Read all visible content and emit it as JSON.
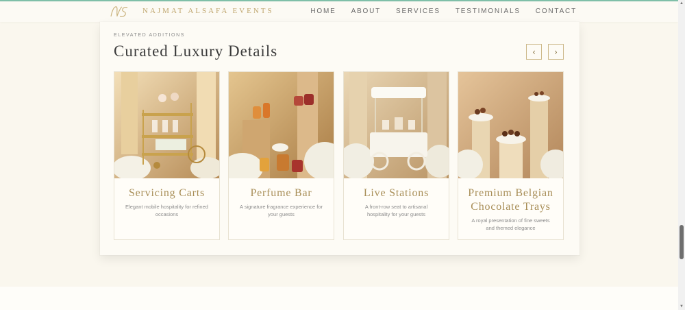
{
  "nav": {
    "brand": "NAJMAT ALSAFA EVENTS",
    "links": [
      "HOME",
      "ABOUT",
      "SERVICES",
      "TESTIMONIALS",
      "CONTACT"
    ]
  },
  "section": {
    "eyebrow": "ELEVATED ADDITIONS",
    "title": "Curated Luxury Details",
    "prev_label": "‹",
    "next_label": "›"
  },
  "cards": [
    {
      "title": "Servicing Carts",
      "description": "Elegant mobile hospitality for refined occasions"
    },
    {
      "title": "Perfume Bar",
      "description": "A signature fragrance experience for your guests"
    },
    {
      "title": "Live Stations",
      "description": "A front-row seat to artisanal hospitality for your guests"
    },
    {
      "title": "Premium Belgian Chocolate Trays",
      "description": "A royal presentation of fine sweets and themed elegance"
    }
  ],
  "colors": {
    "accent_gold": "#bfa66e",
    "card_title": "#a88e57",
    "background": "#faf7ee",
    "top_line": "#7fbfa8"
  }
}
